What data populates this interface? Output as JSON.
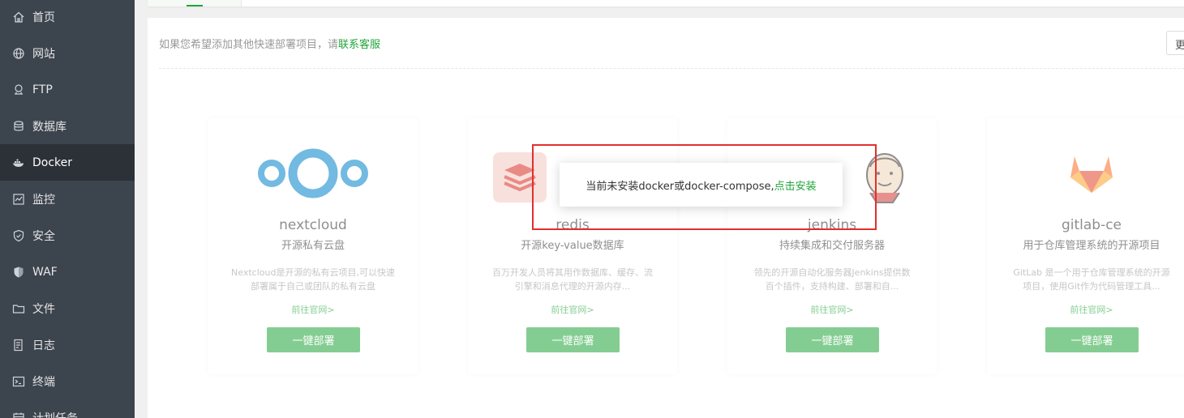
{
  "sidebar": {
    "items": [
      {
        "label": "首页",
        "icon": "home-icon"
      },
      {
        "label": "网站",
        "icon": "globe-icon"
      },
      {
        "label": "FTP",
        "icon": "ftp-icon"
      },
      {
        "label": "数据库",
        "icon": "database-icon"
      },
      {
        "label": "Docker",
        "icon": "docker-icon",
        "active": true
      },
      {
        "label": "监控",
        "icon": "monitor-icon"
      },
      {
        "label": "安全",
        "icon": "shield-check-icon"
      },
      {
        "label": "WAF",
        "icon": "waf-shield-icon"
      },
      {
        "label": "文件",
        "icon": "folder-icon"
      },
      {
        "label": "日志",
        "icon": "log-icon"
      },
      {
        "label": "终端",
        "icon": "terminal-icon"
      },
      {
        "label": "计划任务",
        "icon": "calendar-icon"
      }
    ]
  },
  "hint": {
    "text": "如果您希望添加其他快速部署项目，请",
    "link": "联系客服"
  },
  "more_button": "更",
  "cards": [
    {
      "name": "nextcloud",
      "tagline": "开源私有云盘",
      "desc": "Nextcloud是开源的私有云项目,可以快速部署属于自己或团队的私有云盘",
      "link": "前往官网>",
      "button": "一键部署",
      "logo": "nextcloud-logo"
    },
    {
      "name": "redis",
      "tagline": "开源key-value数据库",
      "desc": "百万开发人员将其用作数据库、缓存、流引擎和消息代理的开源内存...",
      "link": "前往官网>",
      "button": "一键部署",
      "logo": "redis-logo"
    },
    {
      "name": "jenkins",
      "tagline": "持续集成和交付服务器",
      "desc": "领先的开源自动化服务器Jenkins提供数百个插件，支持构建、部署和自...",
      "link": "前往官网>",
      "button": "一键部署",
      "logo": "jenkins-logo"
    },
    {
      "name": "gitlab-ce",
      "tagline": "用于仓库管理系统的开源项目",
      "desc": "GitLab 是一个用于仓库管理系统的开源项目，使用Git作为代码管理工具...",
      "link": "前往官网>",
      "button": "一键部署",
      "logo": "gitlab-logo"
    }
  ],
  "modal": {
    "text": "当前未安装docker或docker-compose,",
    "link": "点击安装"
  },
  "colors": {
    "sidebar_bg": "#3c444d",
    "sidebar_active_bg": "#2c3138",
    "accent": "#20a53a",
    "highlight_border": "#e0302e"
  }
}
